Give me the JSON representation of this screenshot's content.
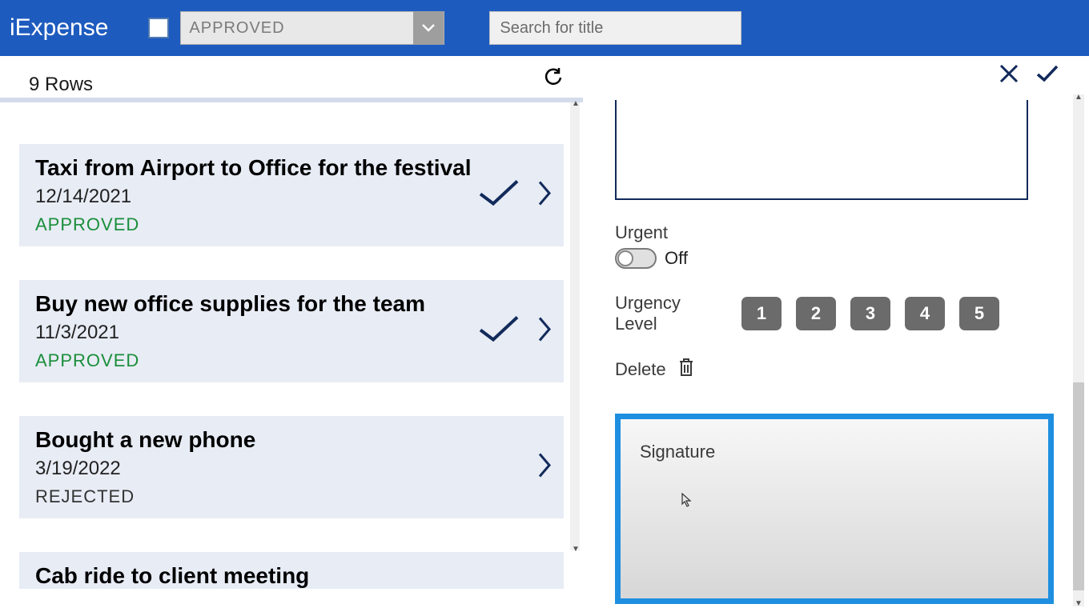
{
  "header": {
    "app_title": "iExpense",
    "filter_value": "APPROVED",
    "search_placeholder": "Search for title"
  },
  "left": {
    "row_count": "9 Rows",
    "items": [
      {
        "title": "Taxi from Airport to Office for the festival",
        "date": "12/14/2021",
        "status": "APPROVED",
        "status_class": "status-approved",
        "show_check": true
      },
      {
        "title": "Buy new office supplies for the team",
        "date": "11/3/2021",
        "status": "APPROVED",
        "status_class": "status-approved",
        "show_check": true
      },
      {
        "title": "Bought a new phone",
        "date": "3/19/2022",
        "status": "REJECTED",
        "status_class": "status-rejected",
        "show_check": false
      },
      {
        "title": "Cab ride to client meeting",
        "date": "",
        "status": "",
        "status_class": "",
        "show_check": false
      }
    ]
  },
  "detail": {
    "urgent_label": "Urgent",
    "toggle_text": "Off",
    "urgency_label": "Urgency Level",
    "levels": [
      "1",
      "2",
      "3",
      "4",
      "5"
    ],
    "delete_label": "Delete",
    "signature_label": "Signature"
  }
}
